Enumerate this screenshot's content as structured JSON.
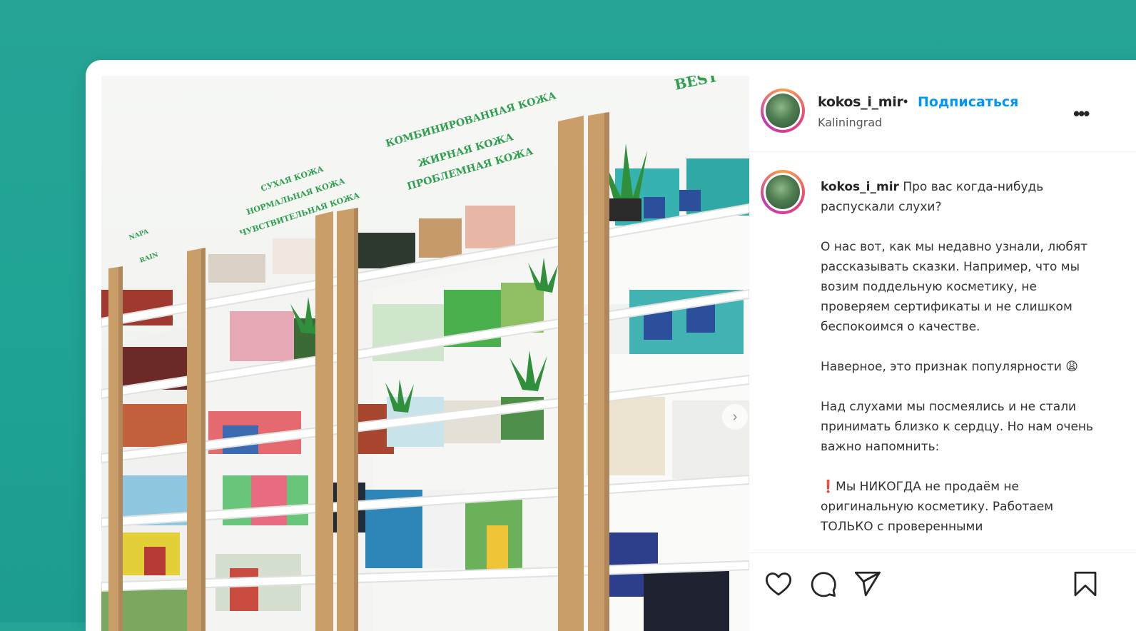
{
  "post": {
    "username": "kokos_i_mir",
    "separator": "•",
    "follow_label": "Подписаться",
    "location": "Kaliningrad",
    "more_label": "•••",
    "carousel_next": "›",
    "photo_signs": {
      "top_right": "BEST",
      "sign1": "КОМБИНИРОВАННАЯ КОЖА",
      "sign2": "ЖИРНАЯ КОЖА",
      "sign3": "ПРОБЛЕМНАЯ КОЖА",
      "sign4": "СУХАЯ КОЖА",
      "sign5": "НОРМАЛЬНАЯ КОЖА",
      "sign6": "ЧУВСТВИТЕЛЬНАЯ КОЖА"
    }
  },
  "caption": {
    "username": "kokos_i_mir",
    "first_line": "Про вас когда-нибудь распускали слухи?",
    "paragraphs": [
      "О нас вот, как мы недавно узнали, любят рассказывать сказки. Например, что мы возим поддельную косметику, не проверяем сертификаты и не слишком беспокоимся о качестве.",
      "Наверное, это признак популярности 😩",
      "Над слухами мы посмеялись и не стали принимать близко к сердцу. Но нам очень важно напомнить:",
      "❗Мы НИКОГДА не продаём не оригинальную косметику. Работаем ТОЛЬКО с проверенными"
    ]
  },
  "icons": {
    "like": "heart-icon",
    "comment": "comment-icon",
    "share": "share-icon",
    "save": "bookmark-icon"
  },
  "colors": {
    "background": "#26a596",
    "follow": "#0095f6",
    "sign_green": "#2e9e4f"
  }
}
